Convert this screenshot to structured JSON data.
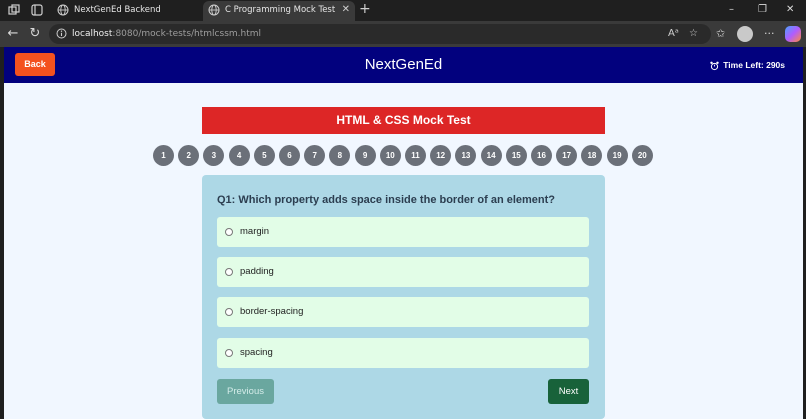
{
  "browser": {
    "tabs": [
      {
        "title": "NextGenEd Backend",
        "active": false
      },
      {
        "title": "C Programming Mock Test",
        "active": true
      }
    ],
    "url_host": "localhost",
    "url_path": ":8080/mock-tests/htmlcssm.html",
    "new_tab_label": "+",
    "window_controls": {
      "minimize": "–",
      "restore": "❐",
      "close": "✕"
    }
  },
  "header": {
    "back_label": "Back",
    "brand": "NextGenEd",
    "timer_label": "Time Left: 290s"
  },
  "test": {
    "title": "HTML & CSS Mock Test",
    "question_numbers": [
      "1",
      "2",
      "3",
      "4",
      "5",
      "6",
      "7",
      "8",
      "9",
      "10",
      "11",
      "12",
      "13",
      "14",
      "15",
      "16",
      "17",
      "18",
      "19",
      "20"
    ],
    "question": "Q1: Which property adds space inside the border of an element?",
    "options": [
      "margin",
      "padding",
      "border-spacing",
      "spacing"
    ],
    "previous_label": "Previous",
    "next_label": "Next"
  },
  "colors": {
    "header_bg": "#02017e",
    "back_button": "#f4511e",
    "title_bar": "#dd2626",
    "card_bg": "#add8e6",
    "option_bg": "#e2fde7",
    "next_button": "#18623a"
  }
}
